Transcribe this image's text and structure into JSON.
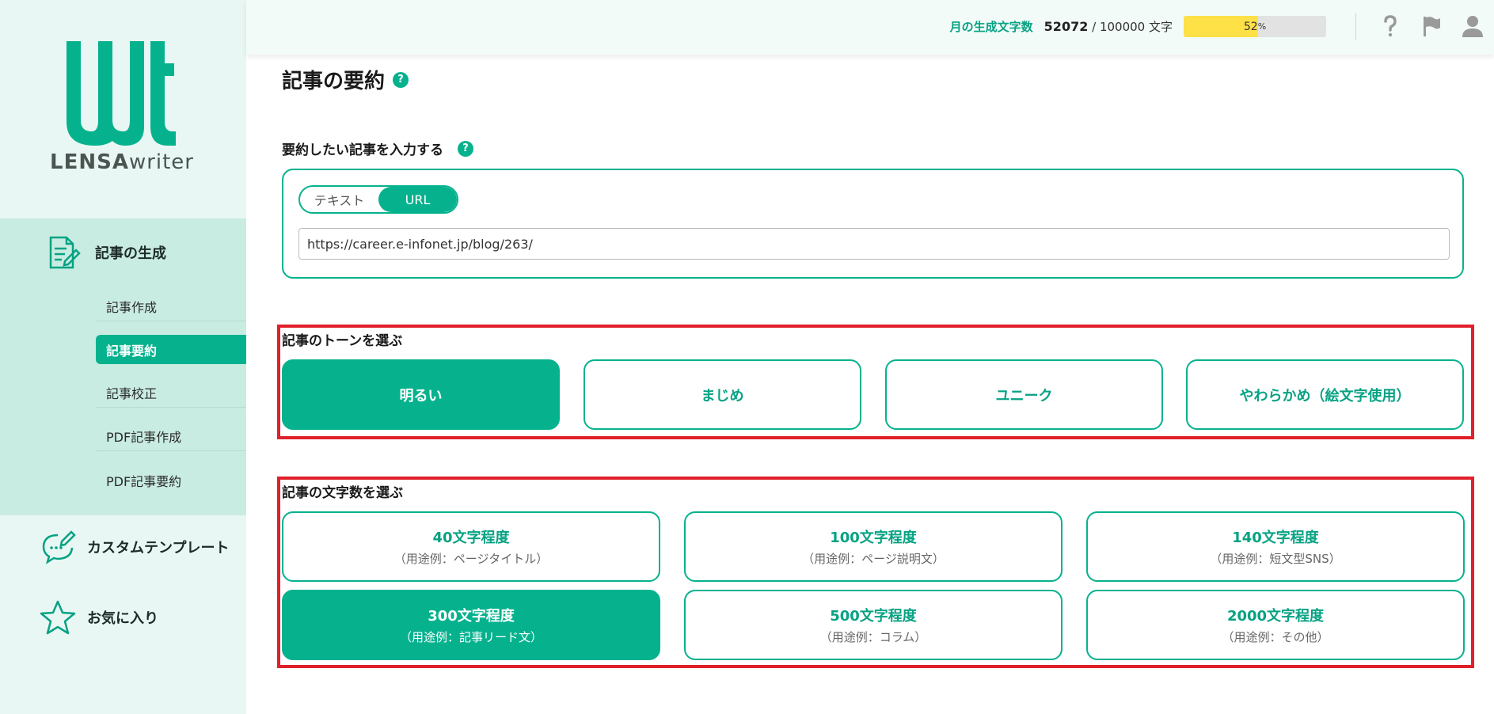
{
  "colors": {
    "accent": "#06b28e",
    "sidebar_bg": "#e8f7f3",
    "nav_group_bg": "#c9ece2",
    "highlight": "#e0202a",
    "progress": "#fee047"
  },
  "logo": {
    "bold": "LENSA",
    "light": "writer"
  },
  "sidebar": {
    "group_title": "記事の生成",
    "sub_items": [
      {
        "label": "記事作成",
        "active": false
      },
      {
        "label": "記事要約",
        "active": true
      },
      {
        "label": "記事校正",
        "active": false
      },
      {
        "label": "PDF記事作成",
        "active": false
      },
      {
        "label": "PDF記事要約",
        "active": false
      }
    ],
    "custom_template": "カスタムテンプレート",
    "favorites": "お気に入り"
  },
  "topbar": {
    "usage_label": "月の生成文字数",
    "used": "52072",
    "separator": " / ",
    "limit": "100000",
    "unit": "文字",
    "percent_value": 52,
    "percent_text": "52",
    "percent_sign": "%",
    "icons": [
      "help-icon",
      "flag-icon",
      "user-icon"
    ]
  },
  "page": {
    "title": "記事の要約",
    "help_glyph": "?",
    "input_label": "要約したい記事を入力する",
    "toggle": {
      "text": "テキスト",
      "url": "URL",
      "selected": "URL"
    },
    "url_value": "https://career.e-infonet.jp/blog/263/",
    "tone_label": "記事のトーンを選ぶ",
    "tones": [
      {
        "label": "明るい",
        "active": true
      },
      {
        "label": "まじめ",
        "active": false
      },
      {
        "label": "ユニーク",
        "active": false
      },
      {
        "label": "やわらかめ（絵文字使用）",
        "active": false
      }
    ],
    "length_label": "記事の文字数を選ぶ",
    "lengths": [
      {
        "label": "40文字程度",
        "example": "（用途例：ページタイトル）",
        "active": false
      },
      {
        "label": "100文字程度",
        "example": "（用途例：ページ説明文）",
        "active": false
      },
      {
        "label": "140文字程度",
        "example": "（用途例：短文型SNS）",
        "active": false
      },
      {
        "label": "300文字程度",
        "example": "（用途例：記事リード文）",
        "active": true
      },
      {
        "label": "500文字程度",
        "example": "（用途例：コラム）",
        "active": false
      },
      {
        "label": "2000文字程度",
        "example": "（用途例：その他）",
        "active": false
      }
    ]
  }
}
